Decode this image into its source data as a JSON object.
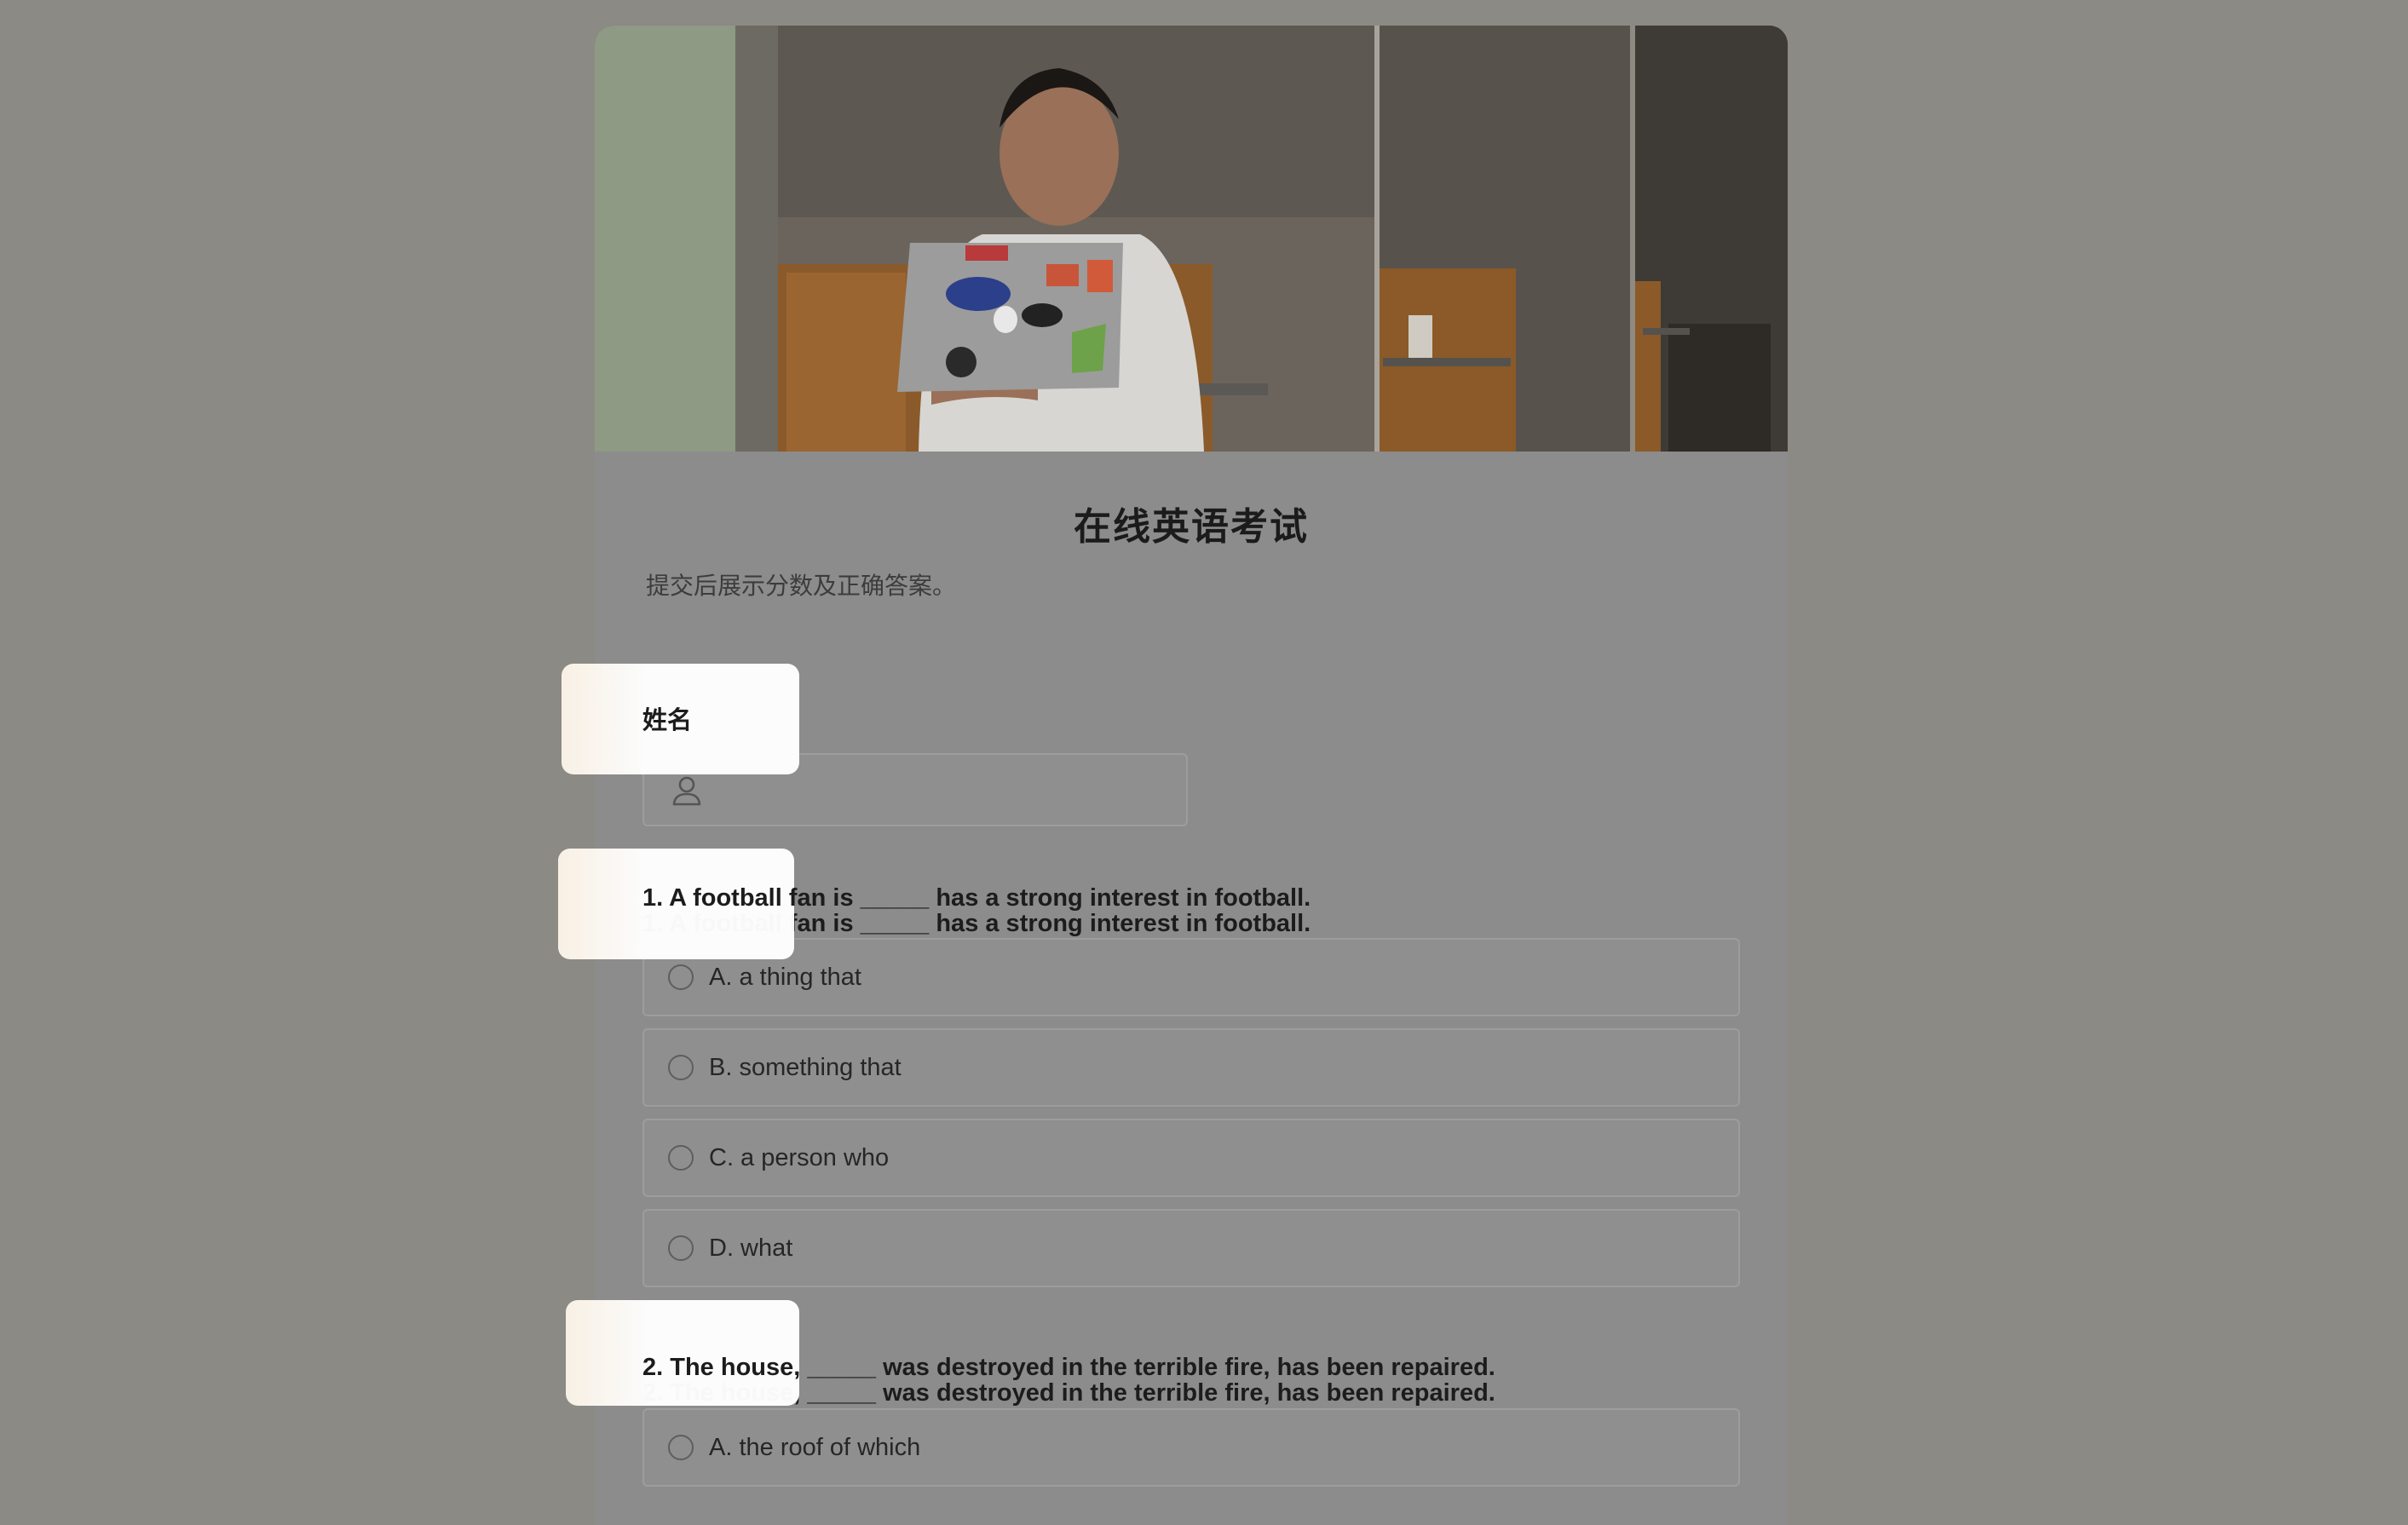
{
  "form": {
    "title": "在线英语考试",
    "subtitle": "提交后展示分数及正确答案。",
    "name_label": "姓名",
    "name_value": "",
    "icons": {
      "name_field": "user-icon",
      "option": "radio-circle-icon"
    }
  },
  "questions": [
    {
      "text": "1. A football fan is _____ has a strong interest in football.",
      "options": [
        {
          "label": "A. a thing that"
        },
        {
          "label": "B. something that"
        },
        {
          "label": "C. a person who"
        },
        {
          "label": "D. what"
        }
      ]
    },
    {
      "text": "2.  The house, _____ was destroyed in the terrible fire, has been repaired.",
      "options": [
        {
          "label": "A. the roof of which"
        }
      ]
    }
  ],
  "colors": {
    "overlay_background": "#8c8a85",
    "card_background": "#8c8c8c",
    "highlight": "#ffffff",
    "title_text": "#1b1b1b"
  }
}
